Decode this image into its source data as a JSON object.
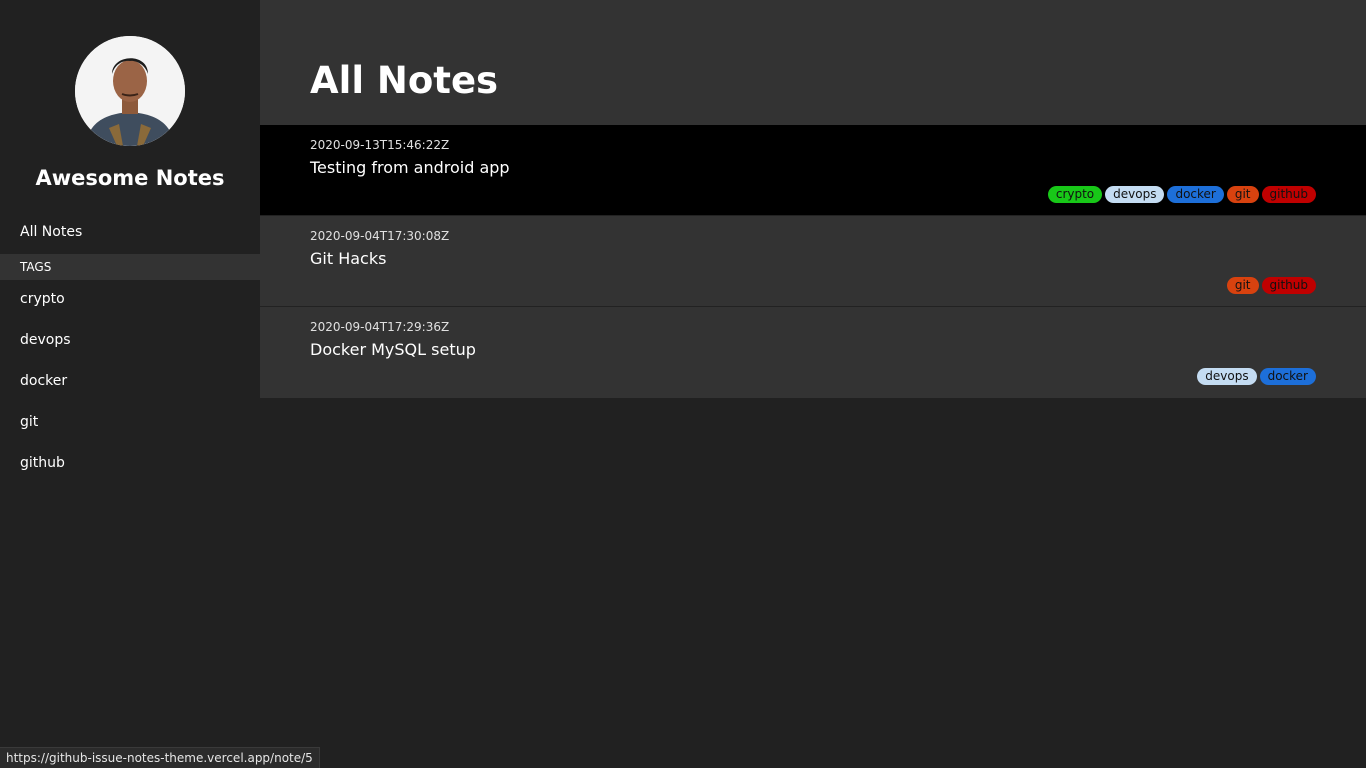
{
  "sidebar": {
    "site_title": "Awesome Notes",
    "all_notes_label": "All Notes",
    "tags_header": "TAGS",
    "tags": [
      "crypto",
      "devops",
      "docker",
      "git",
      "github"
    ]
  },
  "main": {
    "title": "All Notes",
    "notes": [
      {
        "date": "2020-09-13T15:46:22Z",
        "title": "Testing from android app",
        "tags": [
          "crypto",
          "devops",
          "docker",
          "git",
          "github"
        ],
        "active": true
      },
      {
        "date": "2020-09-04T17:30:08Z",
        "title": "Git Hacks",
        "tags": [
          "git",
          "github"
        ],
        "active": false
      },
      {
        "date": "2020-09-04T17:29:36Z",
        "title": "Docker MySQL setup",
        "tags": [
          "devops",
          "docker"
        ],
        "active": false
      }
    ]
  },
  "tag_colors": {
    "crypto": "#18c818",
    "devops": "#c4dcf2",
    "docker": "#1d6fd9",
    "git": "#d8420f",
    "github": "#c00000"
  },
  "status_bar": {
    "url": "https://github-issue-notes-theme.vercel.app/note/5"
  }
}
